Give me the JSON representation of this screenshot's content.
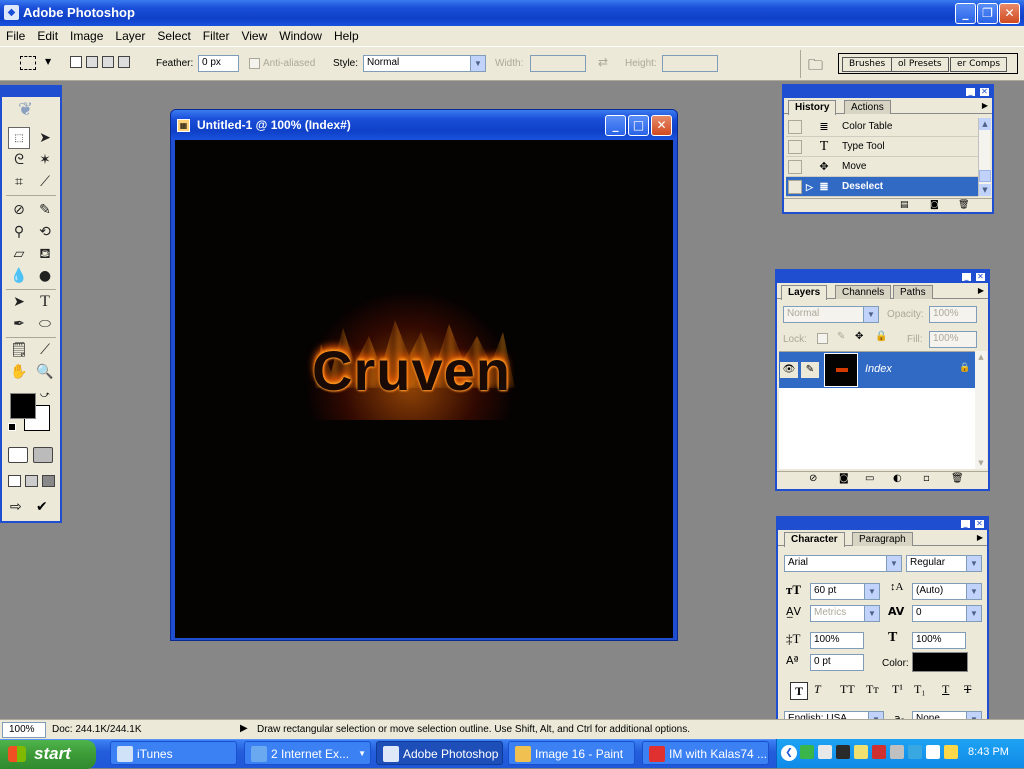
{
  "window": {
    "title": "Adobe Photoshop",
    "min": "_",
    "max": "❐",
    "close": "✕"
  },
  "menu": [
    "File",
    "Edit",
    "Image",
    "Layer",
    "Select",
    "Filter",
    "View",
    "Window",
    "Help"
  ],
  "options": {
    "feather_label": "Feather:",
    "feather_value": "0 px",
    "antialiased_label": "Anti-aliased",
    "style_label": "Style:",
    "style_value": "Normal",
    "width_label": "Width:",
    "height_label": "Height:",
    "well_tabs": [
      "Brushes",
      "ol Presets",
      "er Comps"
    ]
  },
  "document": {
    "title": "Untitled-1 @ 100% (Index#)",
    "text": "Cruven"
  },
  "history": {
    "tabs": [
      "History",
      "Actions"
    ],
    "items": [
      {
        "label": "Color Table",
        "icon": "≣"
      },
      {
        "label": "Type Tool",
        "icon": "T"
      },
      {
        "label": "Move",
        "icon": "✥"
      },
      {
        "label": "Deselect",
        "icon": "≣",
        "selected": true
      }
    ]
  },
  "layers": {
    "tabs": [
      "Layers",
      "Channels",
      "Paths"
    ],
    "blend": "Normal",
    "opacity_label": "Opacity:",
    "opacity": "100%",
    "lock_label": "Lock:",
    "fill_label": "Fill:",
    "fill": "100%",
    "layer_name": "Index"
  },
  "character": {
    "tabs": [
      "Character",
      "Paragraph"
    ],
    "font": "Arial",
    "style": "Regular",
    "size": "60 pt",
    "leading": "(Auto)",
    "kerning": "Metrics",
    "tracking": "0",
    "vscale": "100%",
    "hscale": "100%",
    "baseline": "0 pt",
    "color_label": "Color:",
    "language": "English: USA",
    "aa": "None"
  },
  "status": {
    "zoom": "100%",
    "doc": "Doc: 244.1K/244.1K",
    "hint": "Draw rectangular selection or move selection outline.  Use Shift, Alt, and Ctrl for additional options."
  },
  "taskbar": {
    "start": "start",
    "items": [
      "iTunes",
      "2 Internet Ex...",
      "Adobe Photoshop",
      "Image 16 - Paint",
      "IM with Kalas74 ..."
    ],
    "clock": "8:43 PM"
  },
  "colors": {
    "xp_blue": "#1f4fd0",
    "selection": "#316ac5",
    "fg": "#000000",
    "bg": "#ffffff"
  }
}
